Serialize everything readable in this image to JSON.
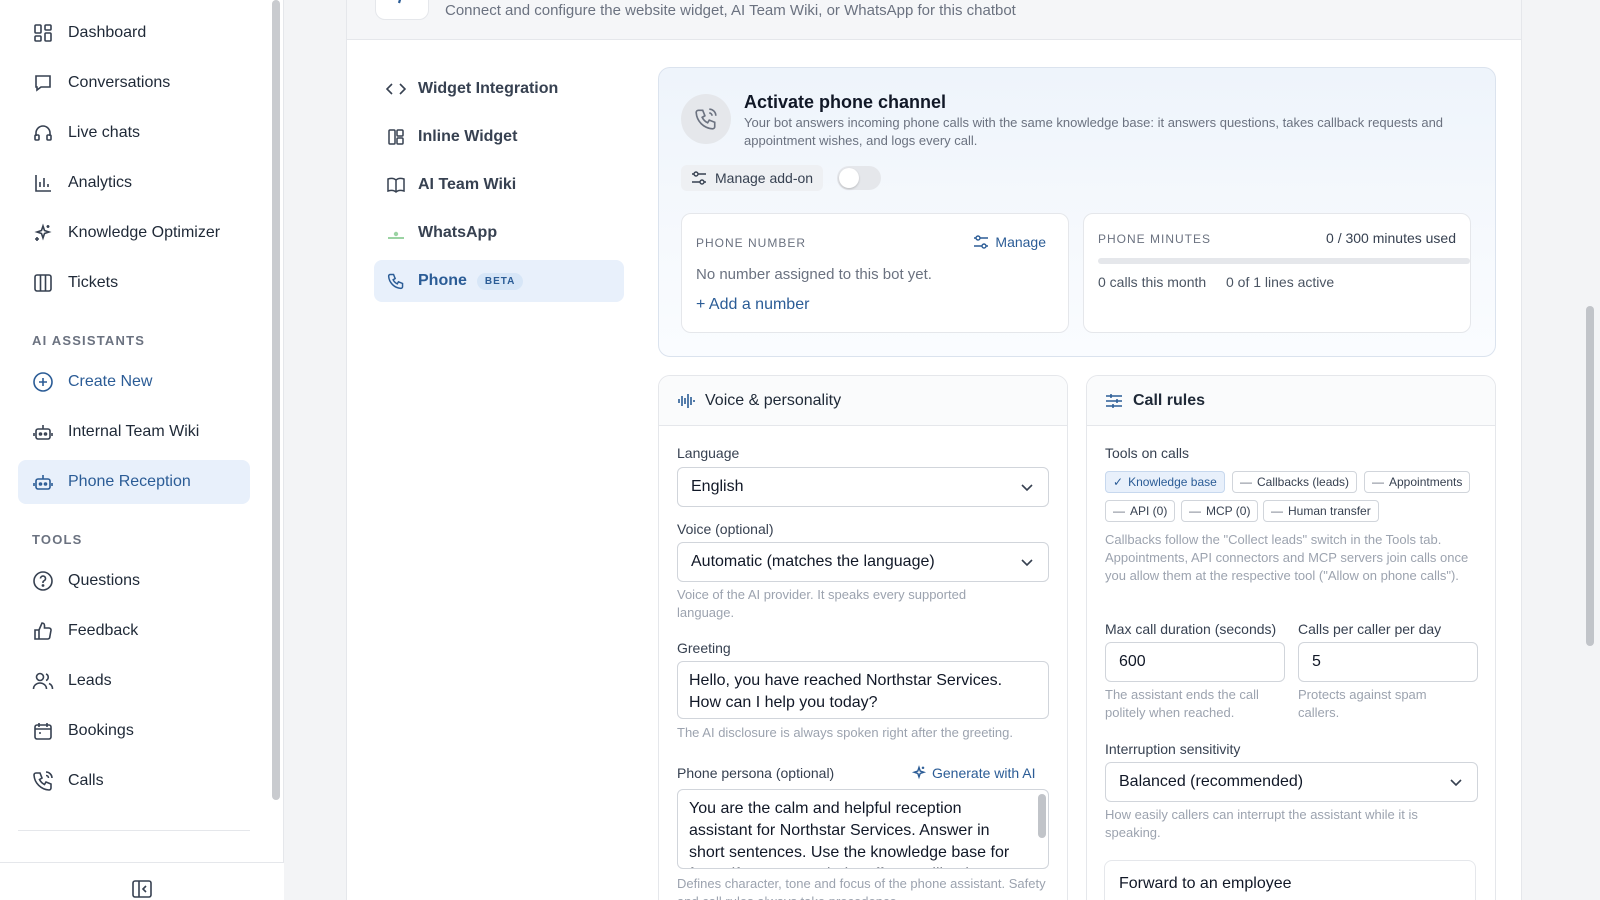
{
  "sidebar": {
    "nav": [
      {
        "label": "Dashboard",
        "icon": "dashboard-icon"
      },
      {
        "label": "Conversations",
        "icon": "chat-bubble-icon"
      },
      {
        "label": "Live chats",
        "icon": "headset-icon"
      },
      {
        "label": "Analytics",
        "icon": "bar-chart-icon"
      },
      {
        "label": "Knowledge Optimizer",
        "icon": "sparkles-icon"
      },
      {
        "label": "Tickets",
        "icon": "columns-icon"
      }
    ],
    "assistants_title": "AI ASSISTANTS",
    "assistants": [
      {
        "label": "Create New",
        "icon": "plus-circle-icon"
      },
      {
        "label": "Internal Team Wiki",
        "icon": "bot-icon"
      },
      {
        "label": "Phone Reception",
        "icon": "bot-icon"
      }
    ],
    "tools_title": "TOOLS",
    "tools": [
      {
        "label": "Questions",
        "icon": "question-circle-icon"
      },
      {
        "label": "Feedback",
        "icon": "thumbs-up-icon"
      },
      {
        "label": "Leads",
        "icon": "users-icon"
      },
      {
        "label": "Bookings",
        "icon": "calendar-icon"
      },
      {
        "label": "Calls",
        "icon": "phone-icon"
      }
    ]
  },
  "header": {
    "subtitle": "Connect and configure the website widget, AI Team Wiki, or WhatsApp for this chatbot"
  },
  "integration_nav": [
    {
      "label": "Widget Integration",
      "icon": "code-icon"
    },
    {
      "label": "Inline Widget",
      "icon": "layout-icon"
    },
    {
      "label": "AI Team Wiki",
      "icon": "book-icon"
    },
    {
      "label": "WhatsApp",
      "icon": "whatsapp-icon"
    },
    {
      "label": "Phone",
      "icon": "phone-icon",
      "badge": "BETA"
    }
  ],
  "activate": {
    "title": "Activate phone channel",
    "description": "Your bot answers incoming phone calls with the same knowledge base: it answers questions, takes callback requests and appointment wishes, and logs every call.",
    "manage_addon": "Manage add-on",
    "toggle_on": false,
    "phone_number": {
      "label": "PHONE NUMBER",
      "manage": "Manage",
      "empty": "No number assigned to this bot yet.",
      "add": "+ Add a number"
    },
    "phone_minutes": {
      "label": "PHONE MINUTES",
      "used_text": "0 / 300 minutes used",
      "used_fraction": 0,
      "calls_month": "0 calls this month",
      "lines_active": "0 of 1 lines active"
    }
  },
  "voice": {
    "title": "Voice & personality",
    "language_label": "Language",
    "language_value": "English",
    "voice_label": "Voice (optional)",
    "voice_value": "Automatic (matches the language)",
    "voice_hint": "Voice of the AI provider. It speaks every supported language.",
    "greeting_label": "Greeting",
    "greeting_value": "Hello, you have reached Northstar Services. How can I help you today?",
    "greeting_hint": "The AI disclosure is always spoken right after the greeting.",
    "persona_label": "Phone persona (optional)",
    "generate_ai": "Generate with AI",
    "persona_value": "You are the calm and helpful reception assistant for Northstar Services. Answer in short sentences. Use the knowledge base for facts; if you cannot help, offer a callback.",
    "persona_hint": "Defines character, tone and focus of the phone assistant. Safety and call rules always take precedence."
  },
  "call_rules": {
    "title": "Call rules",
    "tools_label": "Tools on calls",
    "chips": [
      {
        "label": "Knowledge base",
        "on": true,
        "mark": "✓"
      },
      {
        "label": "Callbacks (leads)",
        "on": false,
        "mark": "—"
      },
      {
        "label": "Appointments",
        "on": false,
        "mark": "—"
      },
      {
        "label": "API (0)",
        "on": false,
        "mark": "—"
      },
      {
        "label": "MCP (0)",
        "on": false,
        "mark": "—"
      },
      {
        "label": "Human transfer",
        "on": false,
        "mark": "—"
      }
    ],
    "tools_hint": "Callbacks follow the \"Collect leads\" switch in the Tools tab. Appointments, API connectors and MCP servers join calls once you allow them at the respective tool (\"Allow on phone calls\").",
    "max_duration_label": "Max call duration (seconds)",
    "max_duration_value": "600",
    "max_duration_hint": "The assistant ends the call politely when reached.",
    "per_caller_label": "Calls per caller per day",
    "per_caller_value": "5",
    "per_caller_hint": "Protects against spam callers.",
    "interruption_label": "Interruption sensitivity",
    "interruption_value": "Balanced (recommended)",
    "interruption_hint": "How easily callers can interrupt the assistant while it is speaking.",
    "forward_title": "Forward to an employee"
  },
  "colors": {
    "accent": "#2b5c96",
    "active_bg": "#e8f0fb"
  }
}
